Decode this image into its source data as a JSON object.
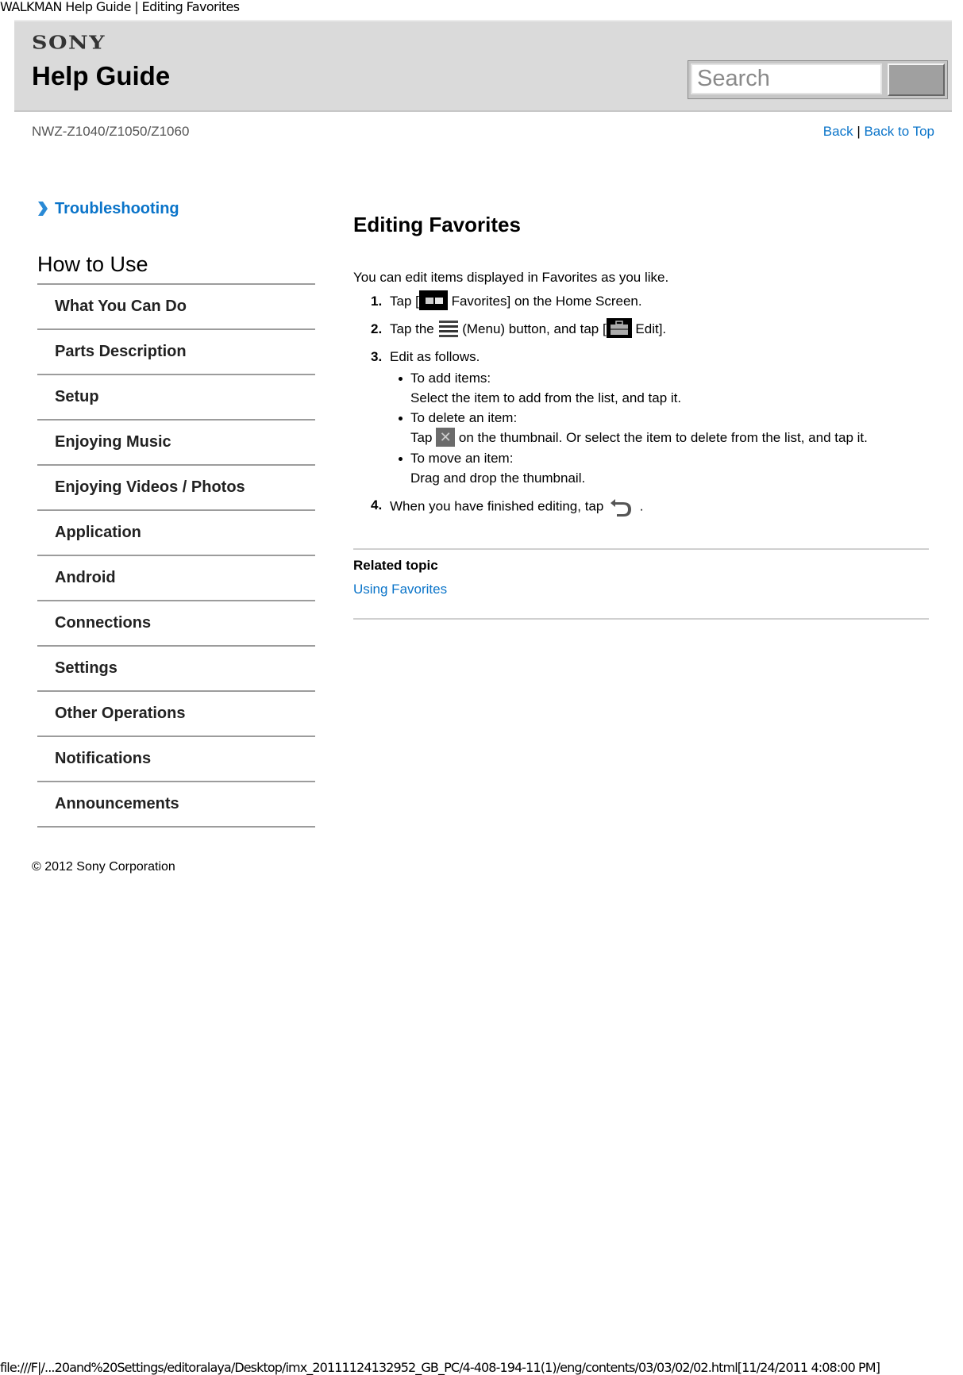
{
  "window": {
    "title": "WALKMAN Help Guide | Editing Favorites"
  },
  "header": {
    "brand": "SONY",
    "title": "Help Guide",
    "search": {
      "placeholder": "Search",
      "value": ""
    }
  },
  "subheader": {
    "model": "NWZ-Z1040/Z1050/Z1060",
    "back_label": "Back",
    "separator": "|",
    "back_to_top_label": "Back to Top"
  },
  "sidebar": {
    "troubleshooting_label": "Troubleshooting",
    "section_title": "How to Use",
    "items": [
      {
        "label": "What You Can Do"
      },
      {
        "label": "Parts Description"
      },
      {
        "label": "Setup"
      },
      {
        "label": "Enjoying Music"
      },
      {
        "label": "Enjoying Videos / Photos"
      },
      {
        "label": "Application"
      },
      {
        "label": "Android"
      },
      {
        "label": "Connections"
      },
      {
        "label": "Settings"
      },
      {
        "label": "Other Operations"
      },
      {
        "label": "Notifications"
      },
      {
        "label": "Announcements"
      }
    ],
    "copyright": "© 2012 Sony Corporation"
  },
  "content": {
    "title": "Editing Favorites",
    "intro": "You can edit items displayed in Favorites as you like.",
    "steps": [
      {
        "num": "1.",
        "pre": "Tap [",
        "icon": "favorites-icon",
        "post": " Favorites] on the Home Screen."
      },
      {
        "num": "2.",
        "pre": "Tap the ",
        "icon": "menu-icon",
        "mid": " (Menu) button, and tap [",
        "icon2": "edit-toolbox-icon",
        "post": " Edit]."
      },
      {
        "num": "3.",
        "text": "Edit as follows.",
        "sub": [
          {
            "head": "To add items:",
            "body": "Select the item to add from the list, and tap it."
          },
          {
            "head": "To delete an item:",
            "body_pre": "Tap ",
            "icon": "delete-x-icon",
            "body_post": " on the thumbnail. Or select the item to delete from the list, and tap it."
          },
          {
            "head": "To move an item:",
            "body": "Drag and drop the thumbnail."
          }
        ]
      },
      {
        "num": "4.",
        "pre": "When you have finished editing, tap ",
        "icon": "back-arrow-icon",
        "post": " ."
      }
    ],
    "related": {
      "heading": "Related topic",
      "links": [
        {
          "label": "Using Favorites"
        }
      ]
    }
  },
  "footer": {
    "url": "file:///F|/...20and%20Settings/editoralaya/Desktop/imx_20111124132952_GB_PC/4-408-194-11(1)/eng/contents/03/03/02/02.html[11/24/2011 4:08:00 PM]"
  },
  "colors": {
    "link": "#0a74c9",
    "header_bg": "#dadada",
    "divider": "#9c9c9c"
  }
}
